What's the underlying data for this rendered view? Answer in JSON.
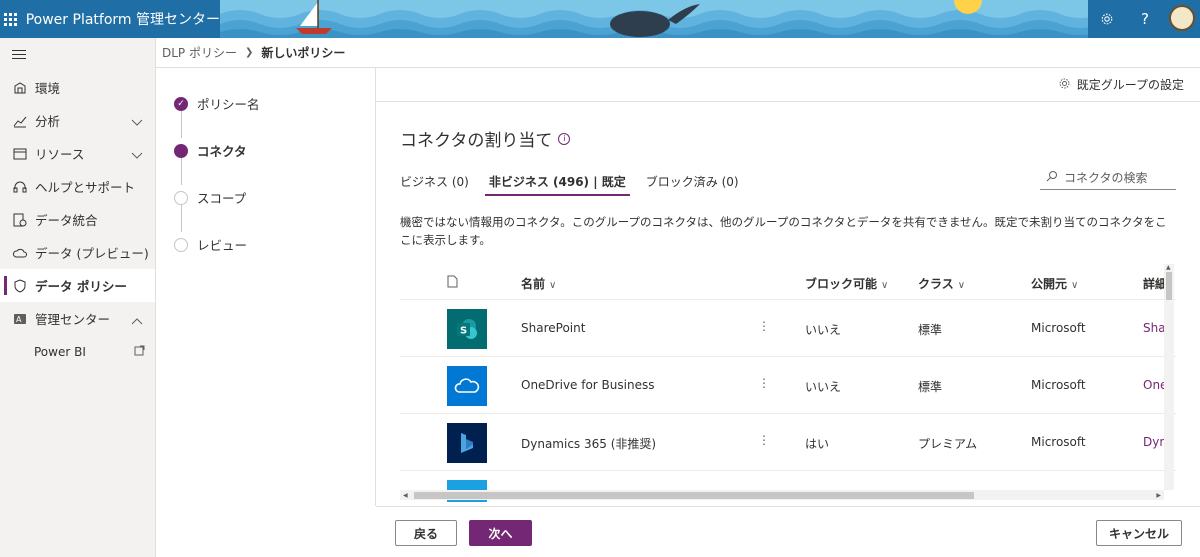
{
  "header": {
    "app_title": "Power Platform 管理センター",
    "settings_icon": "gear-icon",
    "help_icon": "question-icon",
    "avatar_icon": "avatar-icon"
  },
  "nav": {
    "items": [
      {
        "label": "環境",
        "icon": "environment-icon"
      },
      {
        "label": "分析",
        "icon": "analytics-icon"
      },
      {
        "label": "リソース",
        "icon": "resources-icon"
      },
      {
        "label": "ヘルプとサポート",
        "icon": "headset-icon"
      },
      {
        "label": "データ統合",
        "icon": "data-integration-icon"
      },
      {
        "label": "データ (プレビュー)",
        "icon": "cloud-icon"
      },
      {
        "label": "データ ポリシー",
        "icon": "shield-icon"
      },
      {
        "label": "管理センター",
        "icon": "admin-icon"
      }
    ],
    "sub_item": "Power BI"
  },
  "breadcrumb": {
    "parent": "DLP ポリシー",
    "current": "新しいポリシー"
  },
  "steps": [
    {
      "label": "ポリシー名",
      "state": "done"
    },
    {
      "label": "コネクタ",
      "state": "current"
    },
    {
      "label": "スコープ",
      "state": "todo"
    },
    {
      "label": "レビュー",
      "state": "todo"
    }
  ],
  "main": {
    "default_group_settings": "既定グループの設定",
    "title": "コネクタの割り当て",
    "tabs": [
      "ビジネス (0)",
      "非ビジネス (496) | 既定",
      "ブロック済み (0)"
    ],
    "search_placeholder": "コネクタの検索",
    "description": "機密ではない情報用のコネクタ。このグループのコネクタは、他のグループのコネクタとデータを共有できません。既定で未割り当てのコネクタをここに表示します。"
  },
  "table": {
    "columns": [
      "名前",
      "ブロック可能",
      "クラス",
      "公開元",
      "詳細"
    ],
    "rows": [
      {
        "name": "SharePoint",
        "blockable": "いいえ",
        "class": "標準",
        "publisher": "Microsoft",
        "detail": "Shar",
        "icon": "sharepoint-icon",
        "color": "#036C70"
      },
      {
        "name": "OneDrive for Business",
        "blockable": "いいえ",
        "class": "標準",
        "publisher": "Microsoft",
        "detail": "One",
        "icon": "onedrive-icon",
        "color": "#0078D4"
      },
      {
        "name": "Dynamics 365 (非推奨)",
        "blockable": "はい",
        "class": "プレミアム",
        "publisher": "Microsoft",
        "detail": "Dyn",
        "icon": "dynamics-icon",
        "color": "#002050"
      }
    ]
  },
  "footer": {
    "back": "戻る",
    "next": "次へ",
    "cancel": "キャンセル"
  },
  "colors": {
    "accent": "#742774",
    "topbar": "#2b7fb8"
  }
}
